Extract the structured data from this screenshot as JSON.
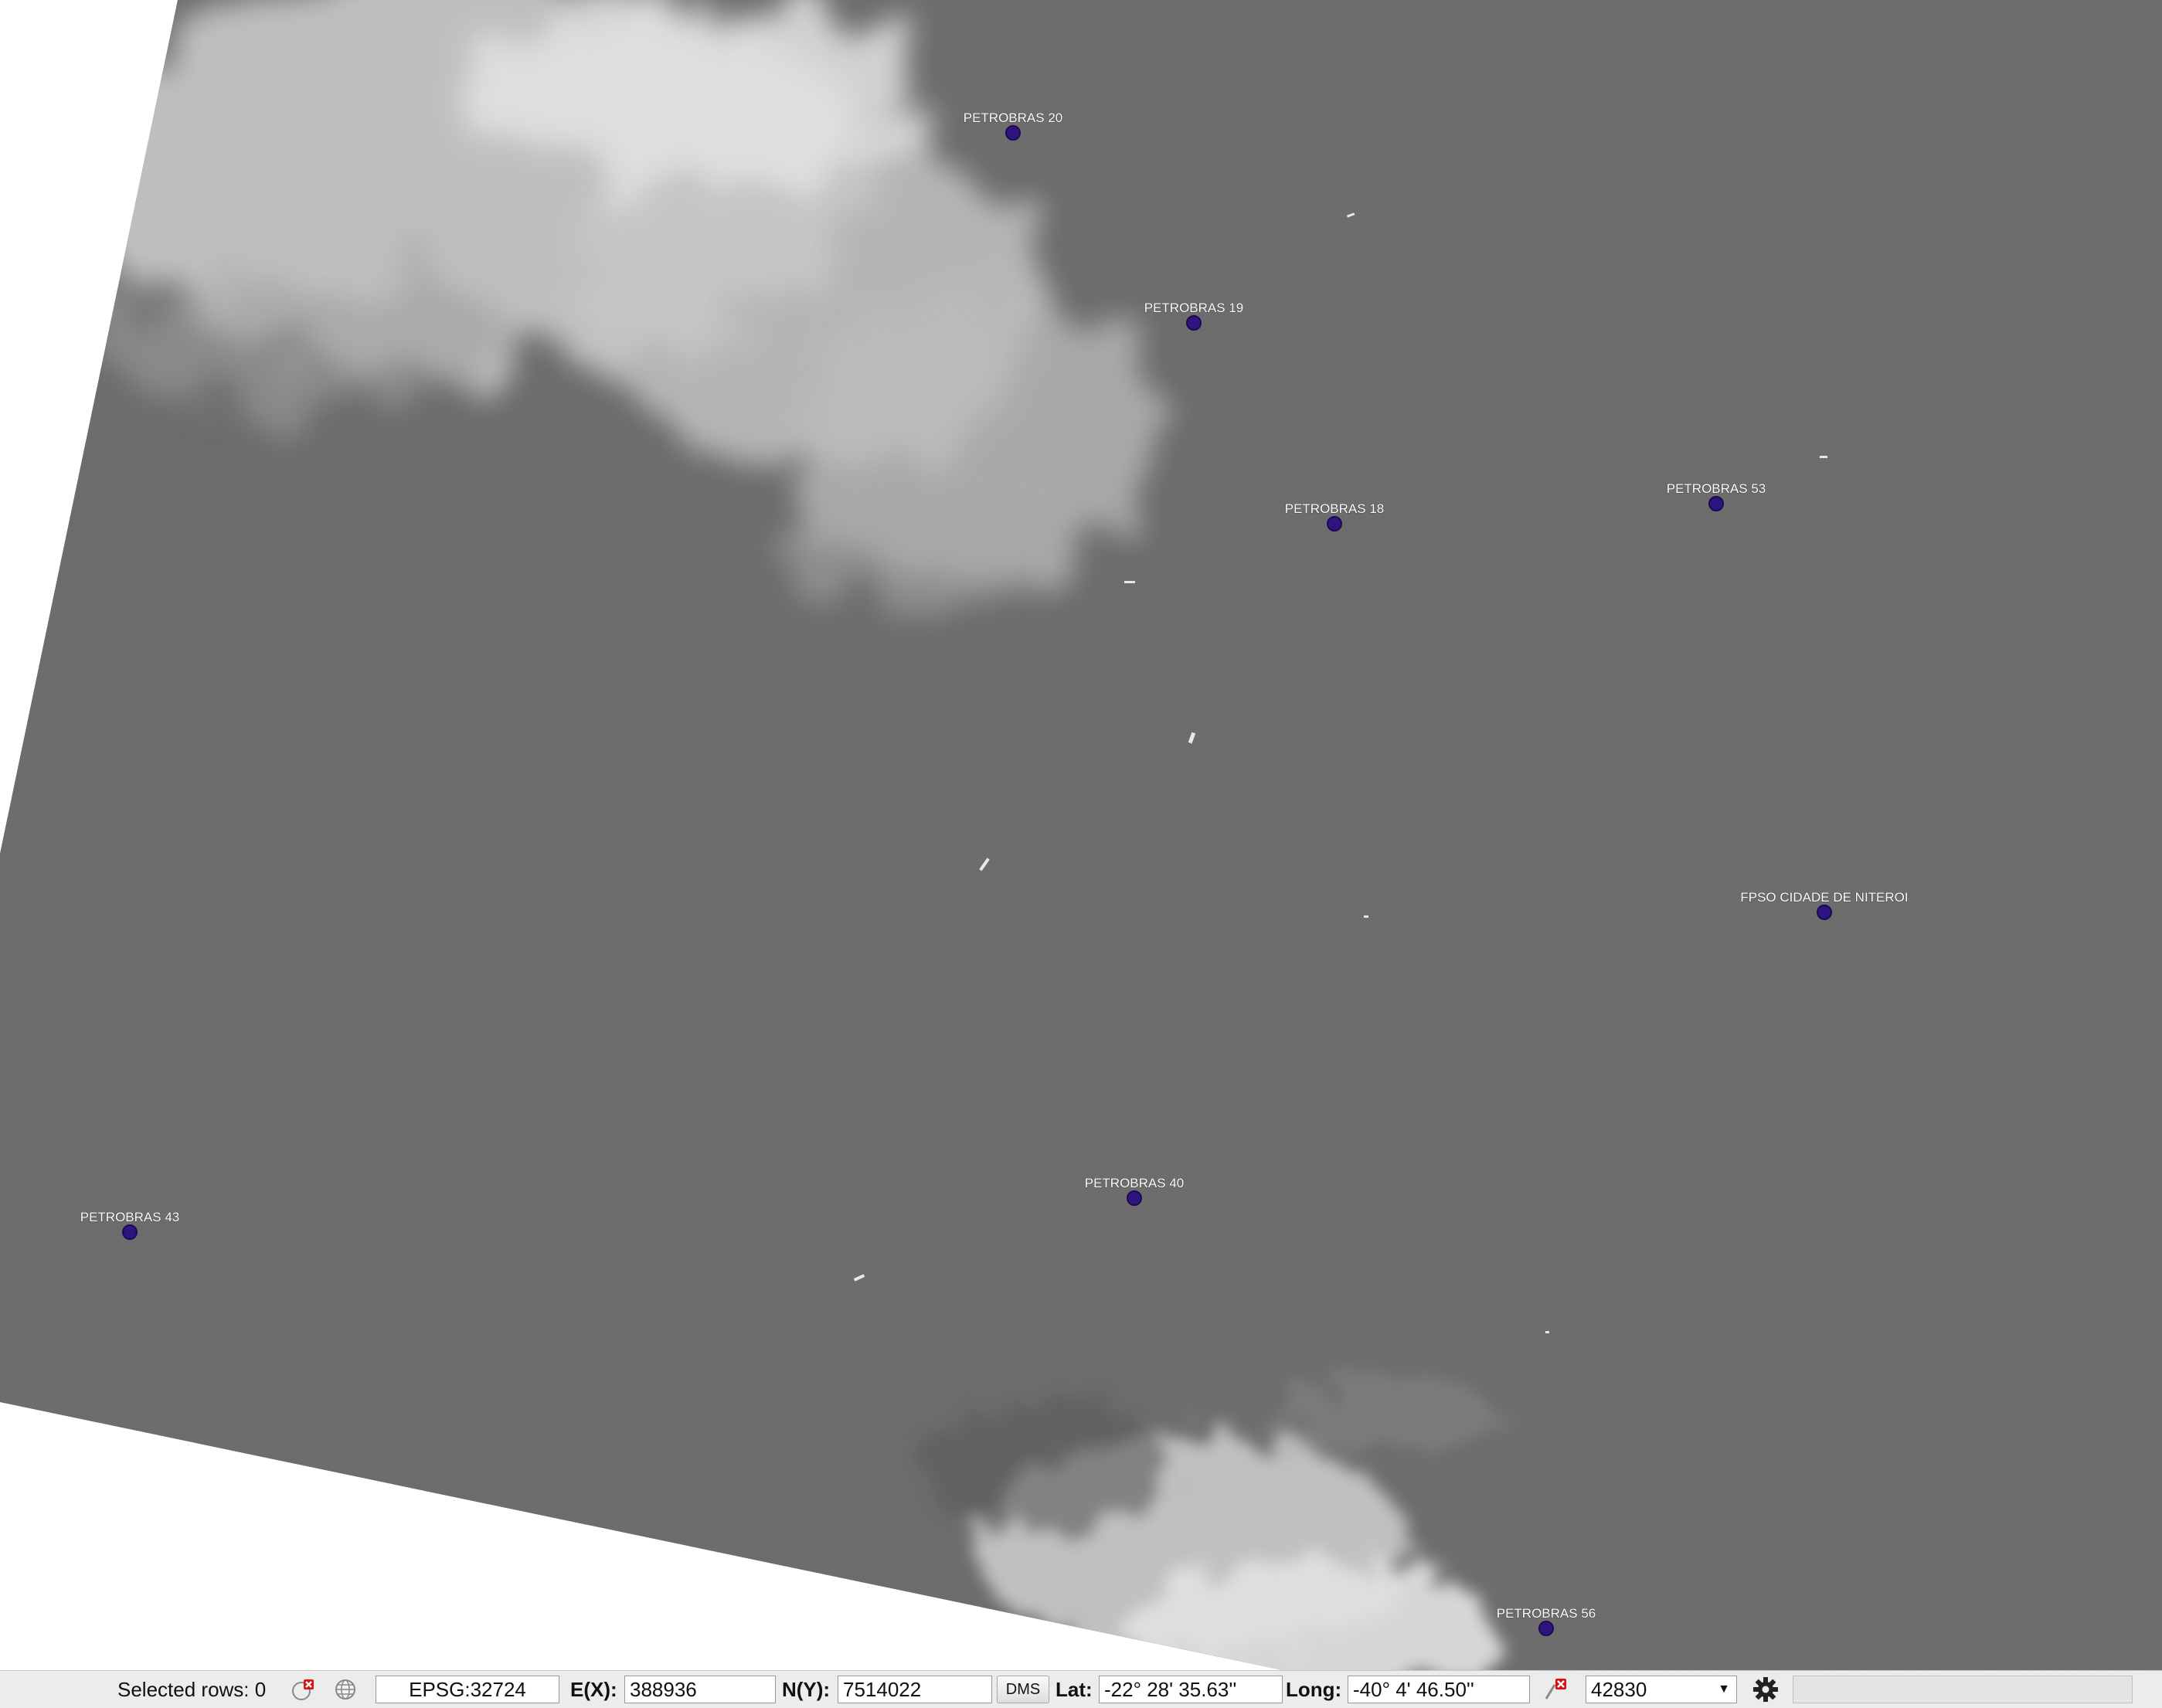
{
  "map": {
    "markers": [
      {
        "label": "PETROBRAS 20"
      },
      {
        "label": "PETROBRAS 19"
      },
      {
        "label": "PETROBRAS 18"
      },
      {
        "label": "PETROBRAS 53"
      },
      {
        "label": "FPSO CIDADE DE NITEROI"
      },
      {
        "label": "PETROBRAS 40"
      },
      {
        "label": "PETROBRAS 43"
      },
      {
        "label": "PETROBRAS 56"
      }
    ],
    "marker_color": "#2d1480",
    "water_color": "#666666",
    "cloud_color": "#d8d8d8"
  },
  "statusbar": {
    "selected_rows": "Selected rows: 0",
    "crs": "EPSG:32724",
    "east_label": "E(X):",
    "east_value": "388936",
    "north_label": "N(Y):",
    "north_value": "7514022",
    "dms_button": "DMS",
    "lat_label": "Lat:",
    "lat_value": "-22° 28' 35.63''",
    "long_label": "Long:",
    "long_value": "-40° 4' 46.50''",
    "scale_value": "42830",
    "icons": {
      "clear_selection": "clear-selection-icon",
      "globe": "globe-icon",
      "clear_scale": "clear-scale-icon",
      "settings": "gear-icon"
    }
  }
}
